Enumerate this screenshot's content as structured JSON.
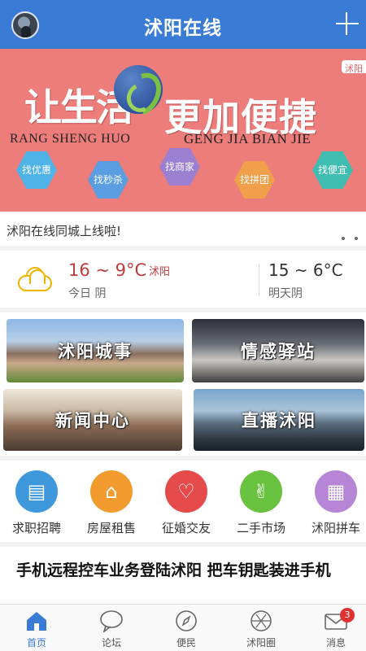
{
  "header": {
    "title": "沭阳在线"
  },
  "banner": {
    "corner_tag": "沭阳",
    "slogan_left": "让生活",
    "slogan_right": "更加便捷",
    "pinyin_left": "RANG SHENG HUO",
    "pinyin_right": "GENG JIA BIAN JIE",
    "chips": [
      {
        "label": "找优惠",
        "color": "#4fb3e8"
      },
      {
        "label": "找秒杀",
        "color": "#5a9de0"
      },
      {
        "label": "找商家",
        "color": "#9b7fd1"
      },
      {
        "label": "找拼团",
        "color": "#f0a04b"
      },
      {
        "label": "找便宜",
        "color": "#3ebdb0"
      }
    ]
  },
  "notice": {
    "text": "沭阳在线同城上线啦!"
  },
  "weather": {
    "today_temp": "16 ~ 9°C",
    "city": "沭阳",
    "today_label": "今日 阴",
    "tomorrow_temp": "15 ~ 6°C",
    "tomorrow_label": "明天阴",
    "icon": "partly-cloudy-icon"
  },
  "tiles": [
    {
      "label": "沭阳城事"
    },
    {
      "label": "情感驿站"
    },
    {
      "label": "新闻中心"
    },
    {
      "label": "直播沭阳"
    }
  ],
  "services": [
    {
      "label": "求职招聘",
      "color": "#3f97dc",
      "icon": "id-card-icon"
    },
    {
      "label": "房屋租售",
      "color": "#f29b2e",
      "icon": "house-icon"
    },
    {
      "label": "征婚交友",
      "color": "#e64b4b",
      "icon": "handshake-icon"
    },
    {
      "label": "二手市场",
      "color": "#68c13f",
      "icon": "victory-hand-icon"
    },
    {
      "label": "沭阳拼车",
      "color": "#b685d6",
      "icon": "car-icon"
    }
  ],
  "headline": {
    "text": "手机远程控车业务登陆沭阳 把车钥匙装进手机"
  },
  "tabbar": {
    "tabs": [
      {
        "label": "首页",
        "icon": "home-icon",
        "active": true
      },
      {
        "label": "论坛",
        "icon": "chat-bubble-icon",
        "active": false
      },
      {
        "label": "便民",
        "icon": "compass-icon",
        "active": false
      },
      {
        "label": "沭阳圈",
        "icon": "aperture-icon",
        "active": false
      },
      {
        "label": "消息",
        "icon": "mail-icon",
        "active": false,
        "badge": "3"
      }
    ]
  },
  "colors": {
    "brand": "#3a7bd5",
    "banner_bg": "#ec7d7b",
    "accent_red": "#c23b3b"
  }
}
